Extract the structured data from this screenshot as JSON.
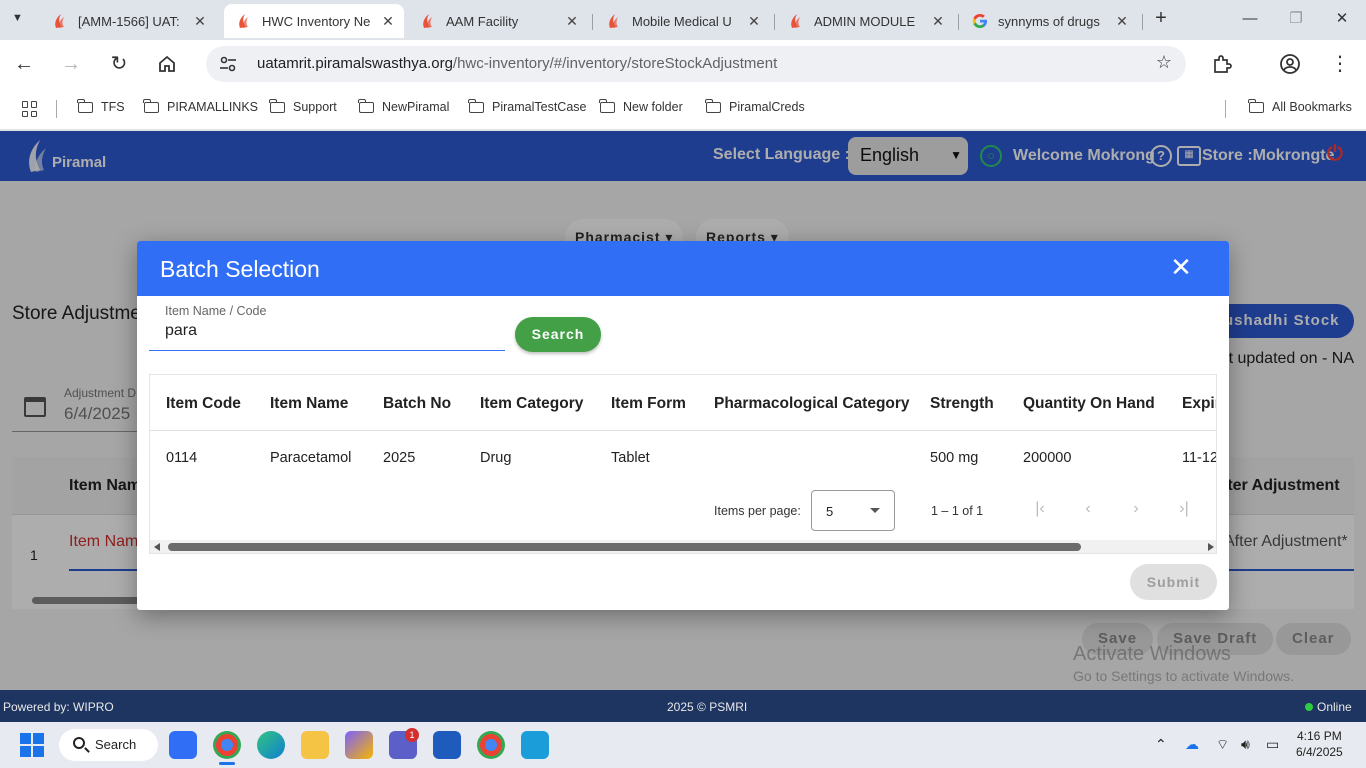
{
  "browser": {
    "tabs": [
      {
        "title": "[AMM-1566] UAT:",
        "icon": "piramal-favicon"
      },
      {
        "title": "HWC Inventory Ne",
        "icon": "piramal-favicon"
      },
      {
        "title": "AAM Facility",
        "icon": "piramal-favicon"
      },
      {
        "title": "Mobile Medical U",
        "icon": "piramal-favicon"
      },
      {
        "title": "ADMIN MODULE",
        "icon": "piramal-favicon"
      },
      {
        "title": "synnyms of drugs",
        "icon": "google-favicon"
      }
    ],
    "url_host": "uatamrit.piramalswasthya.org",
    "url_path": "/hwc-inventory/#/inventory/storeStockAdjustment",
    "bookmarks": [
      "TFS",
      "PIRAMALLINKS",
      "Support",
      "NewPiramal",
      "PiramalTestCase",
      "New folder",
      "PiramalCreds"
    ],
    "all_bookmarks": "All Bookmarks"
  },
  "header": {
    "logo_text": "Piramal",
    "select_language_label": "Select Language :",
    "language": "English",
    "welcome": "Welcome Mokrong",
    "store": "Store :Mokrongte"
  },
  "page": {
    "menu": [
      "Pharmacist",
      "Reports"
    ],
    "title": "Store Adjustme",
    "stock_button": "ushadhi Stock",
    "last_updated": "t updated on - NA",
    "date_label": "Adjustment D",
    "date_value": "6/4/2025",
    "table_headers": {
      "item_name": "Item Nam",
      "after_adjustment": "fter Adjustment"
    },
    "row_number": "1",
    "item_name_placeholder": "Item Nam",
    "after_adjustment_placeholder": "After Adjustment*",
    "buttons": {
      "save": "Save",
      "save_draft": "Save Draft",
      "clear": "Clear"
    },
    "watermark_title": "Activate Windows",
    "watermark_sub": "Go to Settings to activate Windows."
  },
  "modal": {
    "title": "Batch Selection",
    "field_label": "Item Name / Code",
    "field_value": "para",
    "search_label": "Search",
    "columns": [
      "Item Code",
      "Item Name",
      "Batch No",
      "Item Category",
      "Item Form",
      "Pharmacological Category",
      "Strength",
      "Quantity On Hand",
      "Expir"
    ],
    "rows": [
      {
        "item_code": "0114",
        "item_name": "Paracetamol",
        "batch_no": "2025",
        "item_category": "Drug",
        "item_form": "Tablet",
        "pharmacological_category": "",
        "strength": "500 mg",
        "quantity_on_hand": "200000",
        "expiry": "11-12"
      }
    ],
    "items_per_page_label": "Items per page:",
    "items_per_page": "5",
    "range": "1 – 1 of 1",
    "submit_label": "Submit"
  },
  "footer": {
    "powered_by": "Powered by: WIPRO",
    "copyright": "2025 © PSMRI",
    "status": "Online"
  },
  "taskbar": {
    "search": "Search",
    "teams_badge": "1",
    "time": "4:16 PM",
    "date": "6/4/2025"
  }
}
